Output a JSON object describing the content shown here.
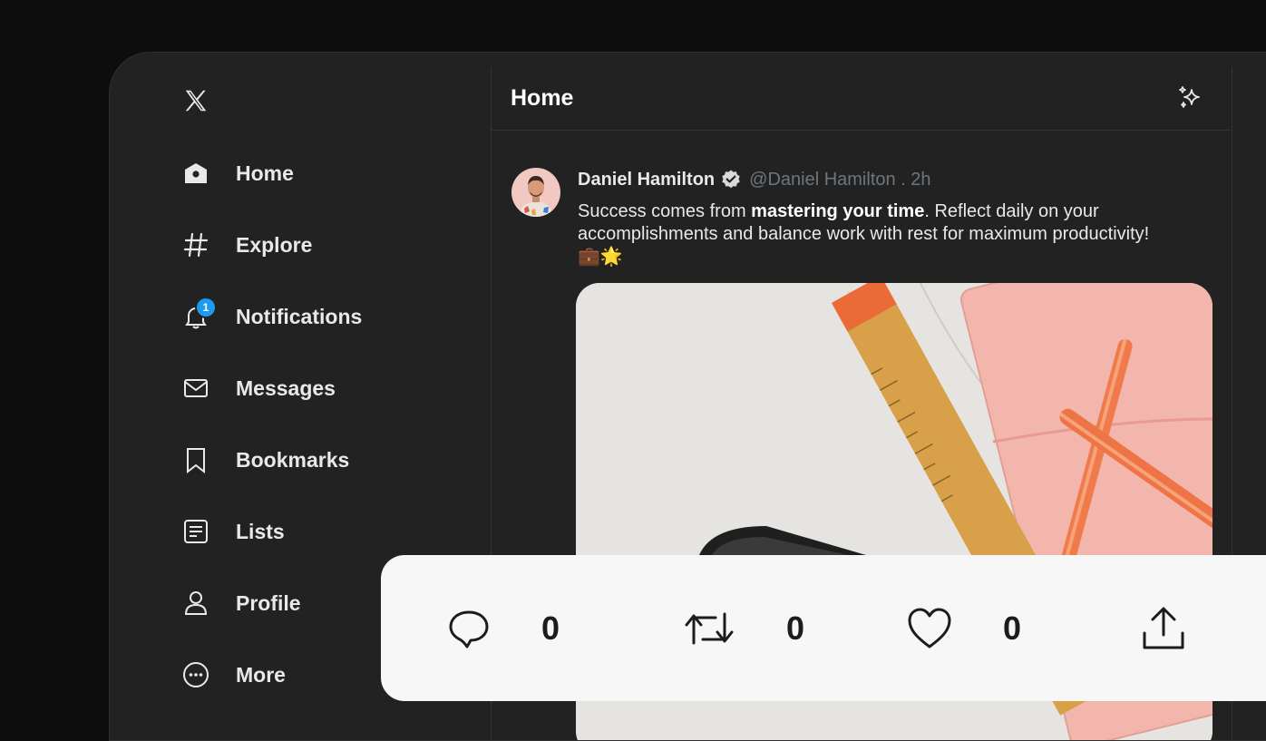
{
  "sidebar": {
    "logo": "x-logo-icon",
    "items": [
      {
        "label": "Home",
        "icon": "home-icon"
      },
      {
        "label": "Explore",
        "icon": "hashtag-icon"
      },
      {
        "label": "Notifications",
        "icon": "bell-icon",
        "badge": "1"
      },
      {
        "label": "Messages",
        "icon": "envelope-icon"
      },
      {
        "label": "Bookmarks",
        "icon": "bookmark-icon"
      },
      {
        "label": "Lists",
        "icon": "list-icon"
      },
      {
        "label": "Profile",
        "icon": "person-icon"
      },
      {
        "label": "More",
        "icon": "more-circle-icon"
      }
    ]
  },
  "header": {
    "title": "Home",
    "icon": "sparkle-icon"
  },
  "tweet": {
    "author": "Daniel Hamilton",
    "handle": "@Daniel Hamilton . 2h",
    "text_before": "Success comes from ",
    "text_bold": "mastering your time",
    "text_after": ". Reflect daily on your accomplishments and balance work with rest for maximum productivity! 💼🌟"
  },
  "actions": {
    "reply_count": "0",
    "retweet_count": "0",
    "like_count": "0"
  },
  "colors": {
    "accent": "#1d9bf0",
    "panel": "#222222",
    "background": "#0d0d0d",
    "action_bar": "#f7f7f7"
  }
}
